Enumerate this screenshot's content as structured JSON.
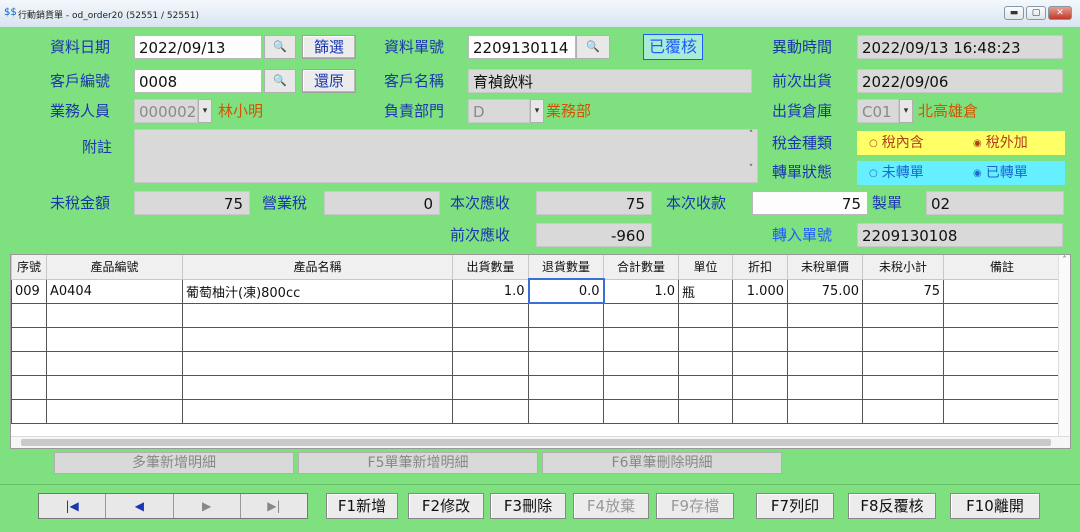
{
  "window": {
    "title": "行動銷貨單 - od_order20   (52551 / 52551)"
  },
  "header": {
    "date_label": "資料日期",
    "date_value": "2022/09/13",
    "filter_button": "篩選",
    "restore_button": "還原",
    "doc_no_label": "資料單號",
    "doc_no_value": "2209130114",
    "status_badge": "已覆核",
    "change_time_label": "異動時間",
    "change_time_value": "2022/09/13 16:48:23",
    "customer_no_label": "客戶編號",
    "customer_no_value": "0008",
    "customer_name_label": "客戶名稱",
    "customer_name_value": "育禎飲料",
    "last_ship_label": "前次出貨",
    "last_ship_value": "2022/09/06",
    "sales_label": "業務人員",
    "sales_code": "000002",
    "sales_name": "林小明",
    "dept_label": "負責部門",
    "dept_code": "D",
    "dept_name": "業務部",
    "warehouse_label": "出貨倉庫",
    "warehouse_code": "C01",
    "warehouse_name": "北高雄倉",
    "memo_label": "附註",
    "tax_type_label": "稅金種類",
    "tax_options": [
      "稅內含",
      "稅外加"
    ],
    "tax_selected": "稅外加",
    "transfer_status_label": "轉單狀態",
    "transfer_options": [
      "未轉單",
      "已轉單"
    ],
    "transfer_selected": "已轉單",
    "pretax_label": "未稅金額",
    "pretax_value": "75",
    "tax_label": "營業稅",
    "tax_value": "0",
    "receivable_label": "本次應收",
    "receivable_value": "75",
    "received_label": "本次收款",
    "received_value": "75",
    "maker_label": "製單",
    "maker_value": "02",
    "prev_receivable_label": "前次應收",
    "prev_receivable_value": "-960",
    "source_no_label": "轉入單號",
    "source_no_value": "2209130108"
  },
  "grid": {
    "columns": [
      "序號",
      "產品編號",
      "產品名稱",
      "出貨數量",
      "退貨數量",
      "合計數量",
      "單位",
      "折扣",
      "未稅單價",
      "未稅小計",
      "備註"
    ],
    "rows": [
      [
        "009",
        "A0404",
        "葡萄柚汁(凍)800cc",
        "1.0",
        "0.0",
        "1.0",
        "瓶",
        "1.000",
        "75.00",
        "75",
        ""
      ]
    ]
  },
  "detail_buttons": {
    "multi_add": "多筆新增明細",
    "single_add": "F5單筆新增明細",
    "single_delete": "F6單筆刪除明細"
  },
  "function_keys": {
    "add": "F1新增",
    "edit": "F2修改",
    "delete": "F3刪除",
    "abandon": "F4放棄",
    "save": "F9存檔",
    "print": "F7列印",
    "unreview": "F8反覆核",
    "exit": "F10離開"
  }
}
